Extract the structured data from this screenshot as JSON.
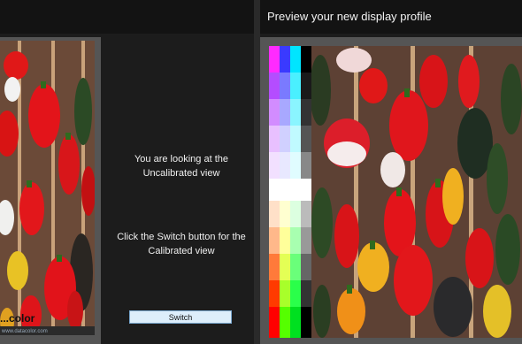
{
  "header": {
    "preview_title": "Preview your new display profile"
  },
  "left_panel": {
    "brand_text": "...color",
    "brand_url": "www.datacolor.com"
  },
  "message": {
    "line1a": "You are looking at the",
    "line1b": "Uncalibrated view",
    "line2a": "Click the Switch button for the",
    "line2b": "Calibrated view"
  },
  "switch_button": {
    "label": "Switch"
  },
  "colors": {
    "background": "#1c1c1c",
    "bar": "#131313",
    "frame": "#555555",
    "button_bg": "#ddeefb",
    "button_border": "#7aa8cf"
  }
}
